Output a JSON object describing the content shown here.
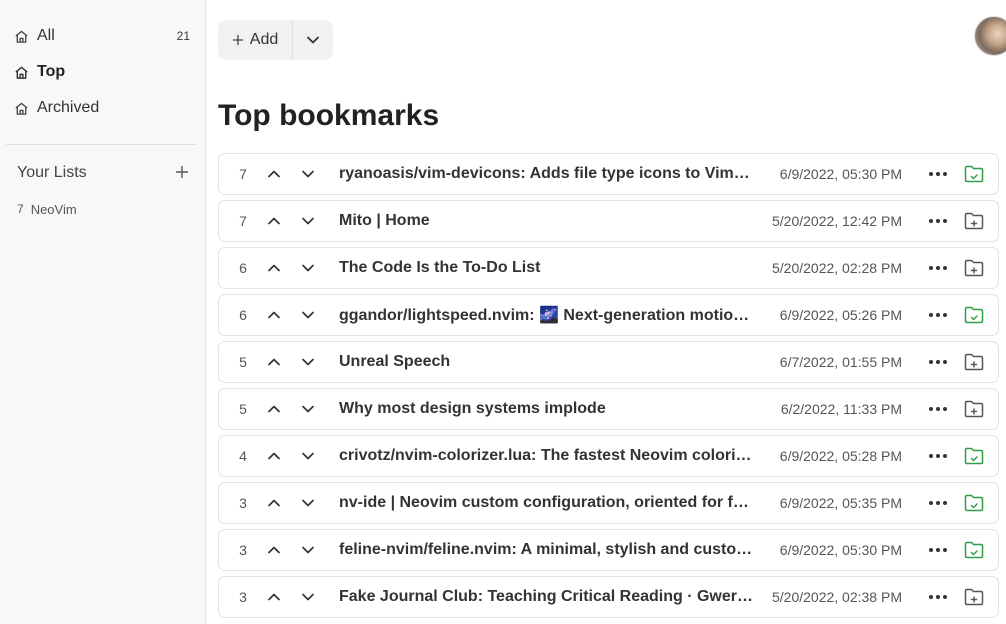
{
  "sidebar": {
    "items": [
      {
        "label": "All",
        "count": "21",
        "icon": "home-icon"
      },
      {
        "label": "Top",
        "count": "",
        "icon": "home-icon"
      },
      {
        "label": "Archived",
        "count": "",
        "icon": "home-icon"
      }
    ],
    "lists_header": "Your Lists",
    "lists": [
      {
        "count": "7",
        "label": "NeoVim"
      }
    ]
  },
  "toolbar": {
    "add_label": "Add"
  },
  "page": {
    "title": "Top bookmarks"
  },
  "colors": {
    "in_list_green": "#2f9e44",
    "folder_gray": "#555555"
  },
  "bookmarks": [
    {
      "score": "7",
      "title": "ryanoasis/vim-devicons: Adds file type icons to Vim plugins such as: NERDTree, vim-airline",
      "date": "6/9/2022, 05:30 PM",
      "in_list": true
    },
    {
      "score": "7",
      "title": "Mito | Home",
      "date": "5/20/2022, 12:42 PM",
      "in_list": false
    },
    {
      "score": "6",
      "title": "The Code Is the To-Do List",
      "date": "5/20/2022, 02:28 PM",
      "in_list": false
    },
    {
      "score": "6",
      "title": "ggandor/lightspeed.nvim: 🌌 Next-generation motion plugin",
      "date": "6/9/2022, 05:26 PM",
      "in_list": true
    },
    {
      "score": "5",
      "title": "Unreal Speech",
      "date": "6/7/2022, 01:55 PM",
      "in_list": false
    },
    {
      "score": "5",
      "title": "Why most design systems implode",
      "date": "6/2/2022, 11:33 PM",
      "in_list": false
    },
    {
      "score": "4",
      "title": "crivotz/nvim-colorizer.lua: The fastest Neovim colorizer",
      "date": "6/9/2022, 05:28 PM",
      "in_list": true
    },
    {
      "score": "3",
      "title": "nv-ide | Neovim custom configuration, oriented for full stack developers",
      "date": "6/9/2022, 05:35 PM",
      "in_list": true
    },
    {
      "score": "3",
      "title": "feline-nvim/feline.nvim: A minimal, stylish and customizable statusline",
      "date": "6/9/2022, 05:30 PM",
      "in_list": true
    },
    {
      "score": "3",
      "title": "Fake Journal Club: Teaching Critical Reading · Gwern.net",
      "date": "5/20/2022, 02:38 PM",
      "in_list": false
    }
  ]
}
